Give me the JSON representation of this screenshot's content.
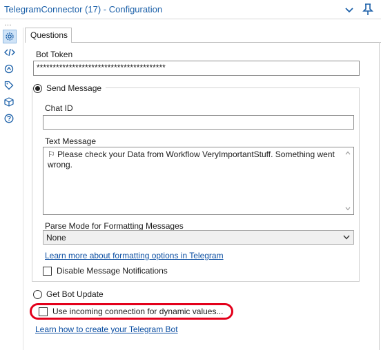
{
  "window": {
    "title": "TelegramConnector (17) - Configuration",
    "overflow_dots": "…",
    "chevron_icon": "chevron-down-icon",
    "pin_icon": "pin-icon"
  },
  "sidebar": {
    "icons": [
      "gear-icon",
      "code-icon",
      "connection-icon",
      "tag-icon",
      "package-icon",
      "help-icon"
    ],
    "active": "gear-icon"
  },
  "tabs": [
    {
      "label": "Questions",
      "selected": true
    }
  ],
  "bot_token": {
    "label": "Bot Token",
    "value": "****************************************"
  },
  "send_message": {
    "label": "Send Message",
    "selected": true,
    "chat_id": {
      "label": "Chat ID",
      "value": ""
    },
    "text_message": {
      "label": "Text Message",
      "value": "⚐ Please check your Data from Workflow VeryImportantStuff. Something went wrong."
    },
    "parse_mode": {
      "label": "Parse Mode for Formatting Messages",
      "selected": "None"
    },
    "formatting_link": "Learn more about formatting options in Telegram",
    "disable_notifications": {
      "label": "Disable Message Notifications",
      "checked": false
    }
  },
  "get_bot_update": {
    "label": "Get Bot Update",
    "selected": false
  },
  "dynamic_values": {
    "label": "Use incoming connection for dynamic values...",
    "checked": false,
    "highlight_color": "#e3001b"
  },
  "create_bot_link": "Learn how to create your Telegram Bot",
  "colors": {
    "title": "#1a5fa8",
    "link": "#0b4ea2",
    "active_icon_bg": "#cfe3f7"
  }
}
